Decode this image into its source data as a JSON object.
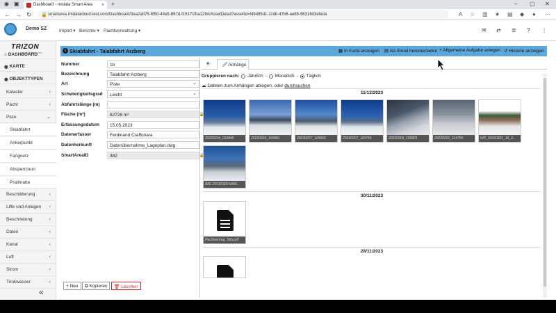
{
  "browser": {
    "tab_title": "Dashboard - rmdata Smart Area",
    "url": "smartarea.rmdatacloud-test.com/Dashboard/3aa2a875-6f50-44e5-867d-f15171fba129#/AssetDetail?assetId=f49485d1-11db-47b6-ae88-9631603efeda"
  },
  "topnav": {
    "user": "Demo SZ",
    "menus": [
      "Import",
      "Berichte",
      "Pachtverwaltung"
    ]
  },
  "sidebar": {
    "brand": "TRIZON",
    "brand_sub": "check your area",
    "items": [
      {
        "label": "DASHBOARD",
        "bold": true
      },
      {
        "label": "KARTE",
        "bold": true
      },
      {
        "label": "OBJEKTTYPEN",
        "bold": true
      },
      {
        "label": "Kataster"
      },
      {
        "label": "Pacht"
      },
      {
        "label": "Piste"
      },
      {
        "label": "Skiabfahrt"
      },
      {
        "label": "Ankerpunkt"
      },
      {
        "label": "Fangnetz"
      },
      {
        "label": "Absperrzaun"
      },
      {
        "label": "Prallmatte"
      },
      {
        "label": "Beschilderung"
      },
      {
        "label": "Lifte und Anlagen"
      },
      {
        "label": "Beschneiung"
      },
      {
        "label": "Daten"
      },
      {
        "label": "Kanal"
      },
      {
        "label": "Luft"
      },
      {
        "label": "Strom"
      },
      {
        "label": "Trinkwasser"
      }
    ]
  },
  "panel": {
    "title": "Skiabfahrt - Talabfahrt Arzberg",
    "buttons": [
      "In Karte anzeigen",
      "Als Excel herunterladen",
      "Allgemeine Aufgabe anlegen",
      "Historie anzeigen"
    ]
  },
  "form": {
    "fields": [
      {
        "label": "Nummer",
        "value": "1b"
      },
      {
        "label": "Bezeichnung",
        "value": "Talabfahrt Arzberg"
      },
      {
        "label": "Art",
        "value": "Piste"
      },
      {
        "label": "Schwierigkeitsgrad",
        "value": "Leicht"
      },
      {
        "label": "Abfahrtslänge (m)",
        "value": ""
      },
      {
        "label": "Fläche (m²)",
        "value": "62728 m²"
      },
      {
        "label": "Erfassungsdatum",
        "value": "15.05.2023"
      },
      {
        "label": "Datenerfasser",
        "value": "Ferdinand Craffonara"
      },
      {
        "label": "Datenherkunft",
        "value": "Datenübernahme_Lageplan.dwg"
      },
      {
        "label": "SmartAreaID",
        "value": "382"
      }
    ]
  },
  "attachments": {
    "tab_label": "Anhänge",
    "group_label": "Gruppieren nach:",
    "group_options": [
      "Jährlich",
      "Monatlich",
      "Täglich"
    ],
    "upload_text": "Dateien zum Anhängen ablegen, oder",
    "upload_link": "durchsuchen",
    "dates": [
      "11/12/2023",
      "30/11/2023",
      "28/11/2023"
    ],
    "files_day1": [
      "20220204_092846",
      "20220203_100901",
      "20230207_123652",
      "20230207_110759",
      "20220203_100801",
      "20220202_114755",
      "WP_20160321_15_2...",
      "IMG-20160320-WA0..."
    ],
    "files_day2": [
      "Pachtvertrag_SIG.pdf"
    ]
  },
  "bottom": {
    "buttons": [
      "Neu",
      "Kopieren",
      "Löschen"
    ]
  },
  "colors": {
    "header": "#5ba7dc",
    "danger": "#c62828"
  }
}
